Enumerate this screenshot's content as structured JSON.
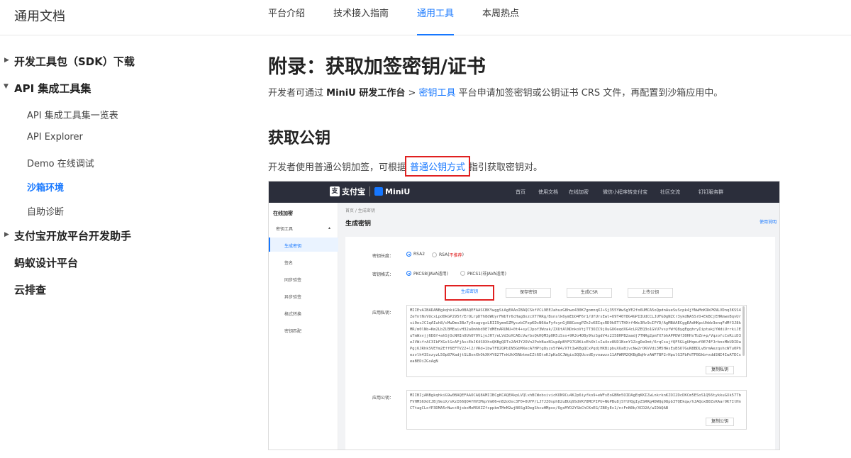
{
  "brand": "通用文档",
  "topnav": [
    {
      "label": "平台介绍",
      "active": false
    },
    {
      "label": "技术接入指南",
      "active": false
    },
    {
      "label": "通用工具",
      "active": true
    },
    {
      "label": "本周热点",
      "active": false
    }
  ],
  "sidebar": {
    "sdk": "开发工具包（SDK）下载",
    "api_tools": "API 集成工具集",
    "sub": [
      "API 集成工具集一览表",
      "API Explorer",
      "Demo 在线调试",
      "沙箱环境",
      "自助诊断"
    ],
    "assistant": "支付宝开放平台开发助手",
    "design": "蚂蚁设计平台",
    "cloud": "云排查"
  },
  "main": {
    "title": "附录：获取加签密钥/证书",
    "intro_pre": "开发者可通过 ",
    "intro_bold": "MiniU 研发工作台",
    "intro_sep": " > ",
    "intro_link": "密钥工具",
    "intro_post": " 平台申请加签密钥或公钥证书 CRS 文件，再配置到沙箱应用中。",
    "section": "获取公钥",
    "sec_pre": "开发者使用普通公钥加签，可根据",
    "sec_link": "普通公钥方式",
    "sec_post": "指引获取密钥对。"
  },
  "shot": {
    "logo1": "支付宝",
    "logo2": "MiniU",
    "nav": [
      "首页",
      "使用文档",
      "在线加密",
      "微信小程序转支付宝",
      "社区交流",
      "钉钉服务群"
    ],
    "side_title": "在线加密",
    "side_group": "密钥工具",
    "side_items": [
      "生成密钥",
      "签名",
      "同步验签",
      "异步验签",
      "格式转换",
      "密钥匹配"
    ],
    "crumb": "首页 / 生成密钥",
    "title": "生成密钥",
    "help": "使用说明",
    "len_label": "密钥长度：",
    "len_opt1": "RSA2",
    "len_opt2": "RSA(",
    "len_opt2_red": "不推荐",
    "len_opt2_end": ")",
    "fmt_label": "密钥格式：",
    "fmt_opt1": "PKCS8(JAVA适用)",
    "fmt_opt2": "PKCS1(非JAVA适用)",
    "buttons": [
      "生成密钥",
      "保存密钥",
      "生成CSR",
      "上传公钥"
    ],
    "priv_label": "应用私钥：",
    "priv_key": "MIIEvAIBADANBgkqhkiG9w0BAQEFAASCBKYwggSiAgEAAoIBAQCSkfVCL9EEJahuzG8hwo430K7gomnqXJ+Sj355YWwSgYE2fo6UMCA5oQpdnAueSuScpk4jYNwMoK9kPKNLVDnq3KSS4ZeTntNsVUcxLpd0kGP295f/ErOLrpDTh8dWUyrFWbTr6cHag8xzcXT7RRg/Bsnslk6ymEbO4F6r1/UfUrsEwl+U9T40Y8G4GPIIUdCCLJUFGDgNZCr3ykdNASSrD+EkBCjEHRmwoBqvUrsi0ecJC1qAIuh8/cMwDms3Bz7yOxugvgxLRII9ymmSZMyczbCPzpKDcN6AaFy4cynGjB8CwsgPZhJsKEIqcRD9kETlTHX+f4Wc3Rv9cIPYD/AgMBAAECggEAdHKpcUhWz3enqFdMf3J8kMR/m0lNb+Km2LbZU3MEaivH32aOmhbd9E7dMEnARUNU+0t4+syCJpof3Wzak/ZXUtAlNDnkoVtjTT3OZC9jOuGUOeqdXG4cLRZEQ3o1GVU7vsyfWfQ8ygEgqhryIiptakjYWdiUrrkiJEuTmWxvjj6D8f+ahSjOcNHInOUhOY0VLjoJH7/eLVd3oXCAEcVw/bxQkHQM3pOR5iSss+9RJo4DBy9hzSgdV4z2I58HPB2aadj7TNRg2pm7X7bhAPPDWf30HHsTbZn+p/VqzofcCoRiiD3eJVW+frAC3IkFXGxlGcAFjAs+EbJK4SOXhsQKBgQDTs2AHJY2OVn2PohBazN1upApBYF97G0KisEhXhlsIa4xz8UD1NsnY1ZcgDeOmt/6rqCsujfQF5GLgUHqeuf0E74FJrbnxMbUDIDaPgj6JRhkSVEYm2Eff6EFTV22+l2/VRd+1bwTF82QPbIN5GbMXecA7HPtg8yzo5fW4/XTtIwKBgQCxPqdjHKBipbuXUaBjvcNw2rOKVVdi3M5HAsEyBSO7GuN8BDLvBrmAezqshcWTu0Phezvlh43SxzyzL5Op87KadjtSLBxnXhOkXK4Y827TnkUhX5NbtmeIZt6EtoKJpKaSCJWgio3QQUcvdEyvoawzx11APWRM2QKBgBqHrzAWF7BP2rHpulGIFbPdTFBGkb+xddSNI4IwATECseaBEDiZGsAgN",
    "copy_priv": "复制私钥",
    "pub_label": "应用公钥：",
    "pub_key": "MIIBIjANBgkqhkiG9w0BAQEFAAOCAQ8AMIIBCgKCAQEAkpLVQlxhBCWobsivicKON9Cu4KJp6iyfko9+eWFsEoGBNn5OIDAgEqKKIZwLnkrknKZOI2DcDKCm5ESoS1Q56tykkuGXk57TbFVHMS6XdCJBj9eiX/sKzI66QO4fHVIMqxVm06+nB2oOsc3F0+0UYP/LJ7JZOsphD2uBUq9SdVK78MCPIPU+NGPBu8jSYlHQgIyZSRRg4DWQq98pb3TQEkqw/hJAQoxB0ZsKAar9K7ItHnCTtagCLofP3DMA5rNwc+BjsboMoMS0ZZfcppkmTMnM2wjB6Sg3DegShcuHMpxo/OgsMYD2YSbChCKnEG/ZBEyEx1/n+FnN0b/XCD2A/wIDAQAB",
    "copy_pub": "复制公钥"
  }
}
